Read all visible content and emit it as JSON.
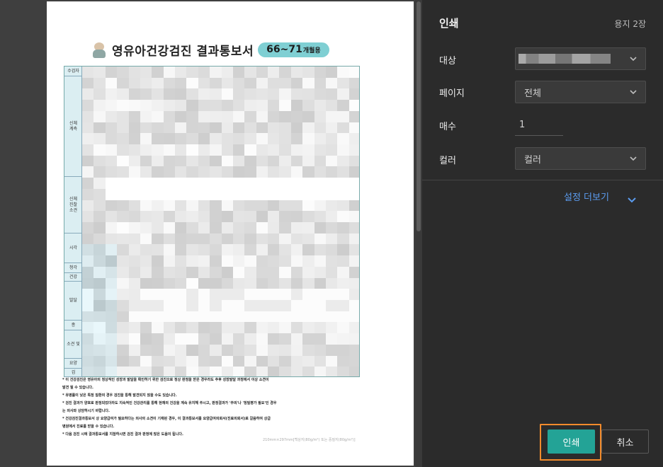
{
  "preview": {
    "document": {
      "title": "영유아건강검진 결과통보서",
      "age_range": "66~71",
      "age_unit": "개월용",
      "side_labels": [
        "수검자",
        "신체\n계측",
        "신체\n진찰\n소견",
        "시각",
        "청각",
        "건강",
        "발달",
        "종",
        "소견 및",
        "요양",
        "검"
      ],
      "notes": [
        "* 이 건강검진은 영유아의 정상적인 성장과 발달을 확인하기 위한 검진으로 정상 판정을 받은 경우라도 추후 성장발달 과정에서 이상 소견이",
        "   발견 될 수 있습니다.",
        "* 유병률이 낮은 특정 질환의 경우 검진을 통해 발견되지 않을 수도 있습니다.",
        "* 검진 결과가 양호로 판정되었더라도 지속적인 건강관리를 통해 현재의 건강을 계속 유지해 주시고, 판정결과가 '주의'나 '정밀평가 필요'인 경우",
        "  는 의사와 상담하시기 바랍니다.",
        "* 건강검진결과통보서 상 요양급여가 필요하다는 의사의 소견이 기재된 경우, 이 결과통보서를 요양급여의뢰서(진료의뢰서)로 갈음하여 상급",
        "  병원에서 진료를 받을 수 있습니다.",
        "* 다음 검진 시에 결과통보서를 지참하시면 검진 결과 판정에 많은 도움이 됩니다."
      ],
      "footer_small": "210mm×297mm[백상지(80g/m²) 또는 중질지(80g/m²)]"
    }
  },
  "panel": {
    "title": "인쇄",
    "sheet_count": "용지 2장",
    "destination_label": "대상",
    "pages_label": "페이지",
    "pages_value": "전체",
    "copies_label": "매수",
    "copies_value": "1",
    "color_label": "컬러",
    "color_value": "컬러",
    "more_settings": "설정 더보기",
    "print_button": "인쇄",
    "cancel_button": "취소"
  },
  "colors": {
    "accent_print": "#23a396",
    "link_blue": "#5b9cf0",
    "highlight_orange": "#f28b2c",
    "panel_bg": "#2b2b2b",
    "badge_teal": "#7fcfd3"
  }
}
